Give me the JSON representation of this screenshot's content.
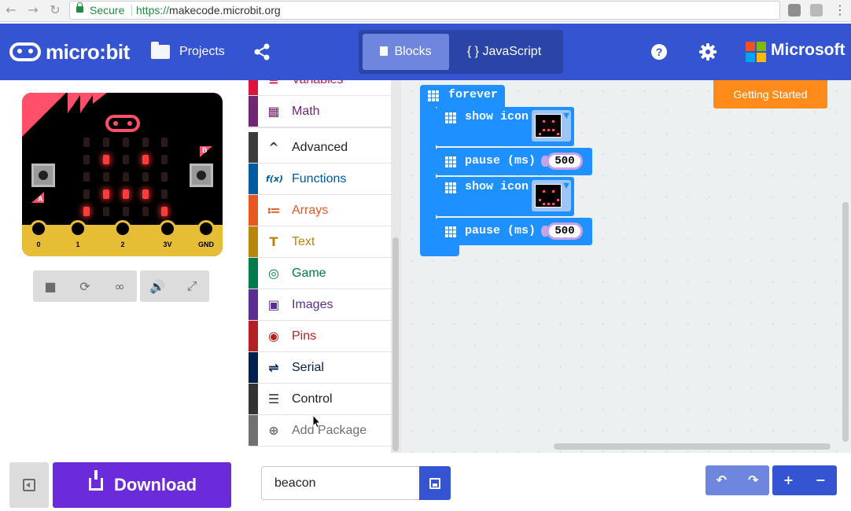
{
  "browser": {
    "back_glyph": "←",
    "forward_glyph": "→",
    "reload_glyph": "↻",
    "secure_label": "Secure",
    "url_scheme": "https://",
    "url_rest": "makecode.microbit.org",
    "menu_glyph": "⋮"
  },
  "header": {
    "logo_text": "micro:bit",
    "projects_label": "Projects",
    "blocks_label": "Blocks",
    "javascript_label": "{ } JavaScript",
    "help_glyph": "?",
    "microsoft_label": "Microsoft",
    "microsoft_colors": [
      "#f25022",
      "#7fba00",
      "#00a4ef",
      "#ffb900"
    ]
  },
  "simulator": {
    "led_matrix": [
      [
        0,
        0,
        0,
        0,
        0
      ],
      [
        0,
        1,
        0,
        1,
        0
      ],
      [
        0,
        0,
        0,
        0,
        0
      ],
      [
        0,
        1,
        1,
        1,
        0
      ],
      [
        1,
        0,
        0,
        0,
        1
      ]
    ],
    "button_a": "A",
    "button_b": "B",
    "pins": [
      "0",
      "1",
      "2",
      "3V",
      "GND"
    ],
    "controls": {
      "stop": "■",
      "restart": "⟳",
      "slowmo": "∞",
      "mute": "🔊",
      "fullscreen": "⤢"
    }
  },
  "toolbox": {
    "items": [
      {
        "label": "Variables",
        "color": "#dc143c",
        "icon": "≡"
      },
      {
        "label": "Math",
        "color": "#712672",
        "icon": "▦"
      },
      {
        "label": "Advanced",
        "color": "#3c3c3c",
        "icon": "^"
      },
      {
        "label": "Functions",
        "color": "#005a9e",
        "icon": "f(x)"
      },
      {
        "label": "Arrays",
        "color": "#e65722",
        "icon": "≔"
      },
      {
        "label": "Text",
        "color": "#b8860b",
        "icon": "T"
      },
      {
        "label": "Game",
        "color": "#007a4b",
        "icon": "◎"
      },
      {
        "label": "Images",
        "color": "#5c2d91",
        "icon": "▣"
      },
      {
        "label": "Pins",
        "color": "#b22222",
        "icon": "◉"
      },
      {
        "label": "Serial",
        "color": "#002050",
        "icon": "⇌"
      },
      {
        "label": "Control",
        "color": "#333333",
        "icon": "☰"
      },
      {
        "label": "Add Package",
        "color": "#717171",
        "icon": "⊕"
      }
    ]
  },
  "workspace": {
    "getting_started_label": "Getting Started",
    "forever_label": "forever",
    "blocks": [
      {
        "text": "show icon"
      },
      {
        "text": "pause (ms)",
        "value": "500"
      },
      {
        "text": "show icon"
      },
      {
        "text": "pause (ms)",
        "value": "500"
      }
    ]
  },
  "bottom": {
    "download_label": "Download",
    "project_name": "beacon",
    "undo_glyph": "↶",
    "redo_glyph": "↷",
    "zoom_in_glyph": "+",
    "zoom_out_glyph": "−"
  }
}
